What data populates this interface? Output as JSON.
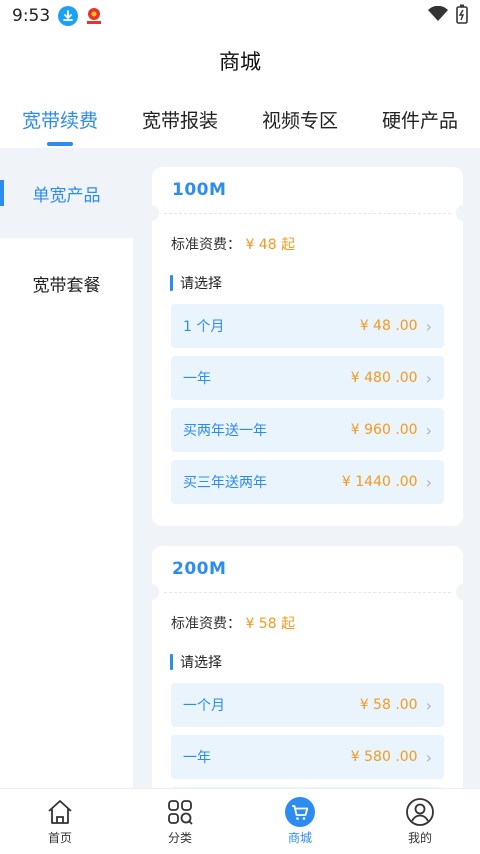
{
  "status": {
    "time": "9:53"
  },
  "header": {
    "title": "商城"
  },
  "tabs": [
    {
      "label": "宽带续费",
      "active": true
    },
    {
      "label": "宽带报装"
    },
    {
      "label": "视频专区"
    },
    {
      "label": "硬件产品"
    }
  ],
  "sidebar": {
    "items": [
      {
        "label": "单宽产品",
        "active": true
      },
      {
        "label": "宽带套餐"
      }
    ]
  },
  "products": [
    {
      "title": "100M",
      "std_label": "标准资费：",
      "std_price": "¥ 48 起",
      "choose_label": "请选择",
      "options": [
        {
          "label": "1 个月",
          "price": "¥ 48 .00"
        },
        {
          "label": "一年",
          "price": "¥ 480 .00"
        },
        {
          "label": "买两年送一年",
          "price": "¥ 960 .00"
        },
        {
          "label": "买三年送两年",
          "price": "¥ 1440 .00"
        }
      ]
    },
    {
      "title": "200M",
      "std_label": "标准资费：",
      "std_price": "¥ 58 起",
      "choose_label": "请选择",
      "options": [
        {
          "label": "一个月",
          "price": "¥ 58 .00"
        },
        {
          "label": "一年",
          "price": "¥ 580 .00"
        },
        {
          "label": "",
          "price": ""
        }
      ]
    }
  ],
  "bottom_nav": [
    {
      "label": "首页",
      "icon": "home-icon"
    },
    {
      "label": "分类",
      "icon": "category-icon"
    },
    {
      "label": "商城",
      "icon": "cart-icon",
      "active": true
    },
    {
      "label": "我的",
      "icon": "user-icon"
    }
  ],
  "colors": {
    "accent": "#2d8cf0",
    "price": "#f39a1f",
    "option_bg": "#eaf4fd",
    "page_bg": "#f0f3f8"
  }
}
